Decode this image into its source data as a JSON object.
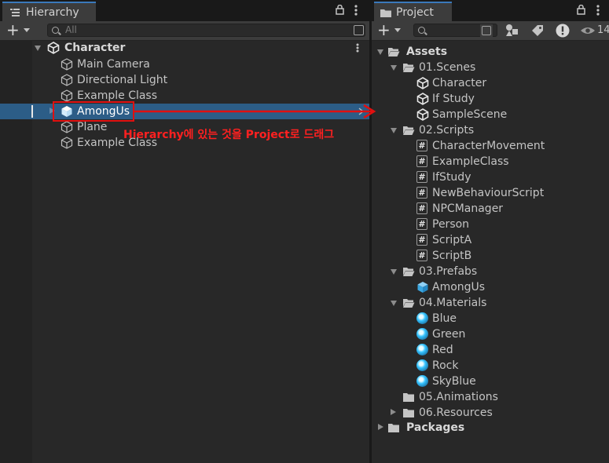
{
  "hierarchy": {
    "tab_label": "Hierarchy",
    "search_placeholder": "All",
    "scene": "Character",
    "items": [
      "Main Camera",
      "Directional Light",
      "Example Class",
      "AmongUs",
      "Plane",
      "Example Class"
    ],
    "selected_item": "AmongUs"
  },
  "project": {
    "tab_label": "Project",
    "badge_count": "14",
    "root": "Assets",
    "folders": [
      {
        "name": "01.Scenes",
        "items": [
          "Character",
          "If Study",
          "SampleScene"
        ]
      },
      {
        "name": "02.Scripts",
        "items": [
          "CharacterMovement",
          "ExampleClass",
          "IfStudy",
          "NewBehaviourScript",
          "NPCManager",
          "Person",
          "ScriptA",
          "ScriptB"
        ]
      },
      {
        "name": "03.Prefabs",
        "items": [
          "AmongUs"
        ]
      },
      {
        "name": "04.Materials",
        "items": [
          "Blue",
          "Green",
          "Red",
          "Rock",
          "SkyBlue"
        ]
      },
      {
        "name": "05.Animations",
        "items": []
      },
      {
        "name": "06.Resources",
        "items": []
      }
    ],
    "packages": "Packages"
  },
  "annotation": {
    "text": "Hierarchy에 있는 것을 Project로 드래그",
    "color": "#e01010"
  },
  "colors": {
    "selection": "#2c5d87",
    "tab_accent": "#3a79bb",
    "material_blue": "#33c3ff"
  }
}
